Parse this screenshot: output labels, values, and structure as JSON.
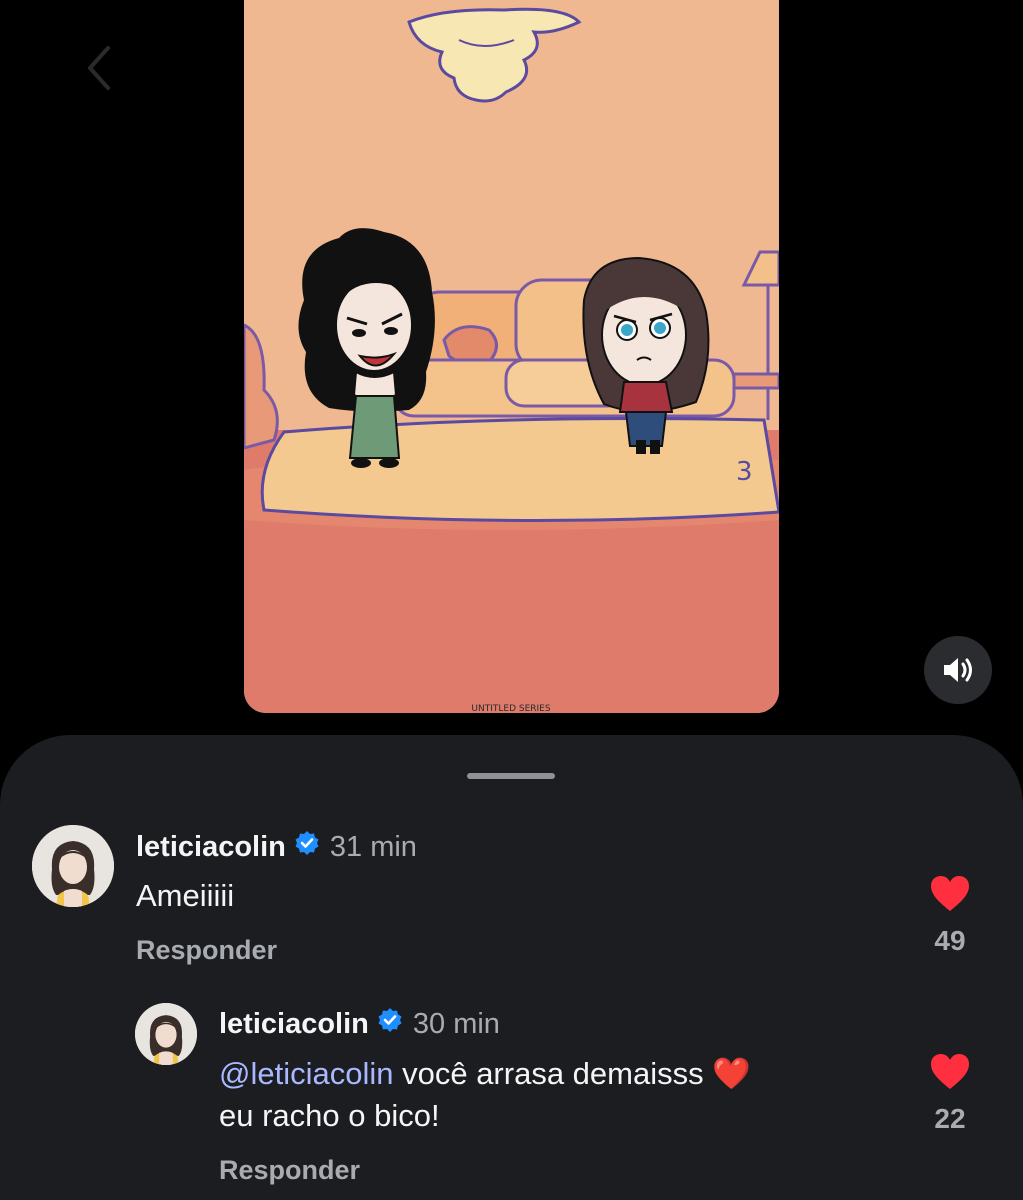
{
  "video": {
    "caption_strip": "UNTITLED SERIES",
    "sound_icon": "speaker-icon"
  },
  "colors": {
    "sheet_bg": "#1b1d21",
    "like_red": "#ff2f40",
    "verified_blue": "#1f8eff",
    "mention": "#a9b8ff"
  },
  "comments": [
    {
      "username": "leticiacolin",
      "time": "31 min",
      "text": "Ameiiiii",
      "reply_label": "Responder",
      "likes": "49"
    },
    {
      "username": "leticiacolin",
      "time": "30 min",
      "mention": "@leticiacolin",
      "text_line1": " você arrasa demaisss ❤️",
      "text_line2": "eu racho o bico!",
      "reply_label": "Responder",
      "likes": "22"
    }
  ]
}
